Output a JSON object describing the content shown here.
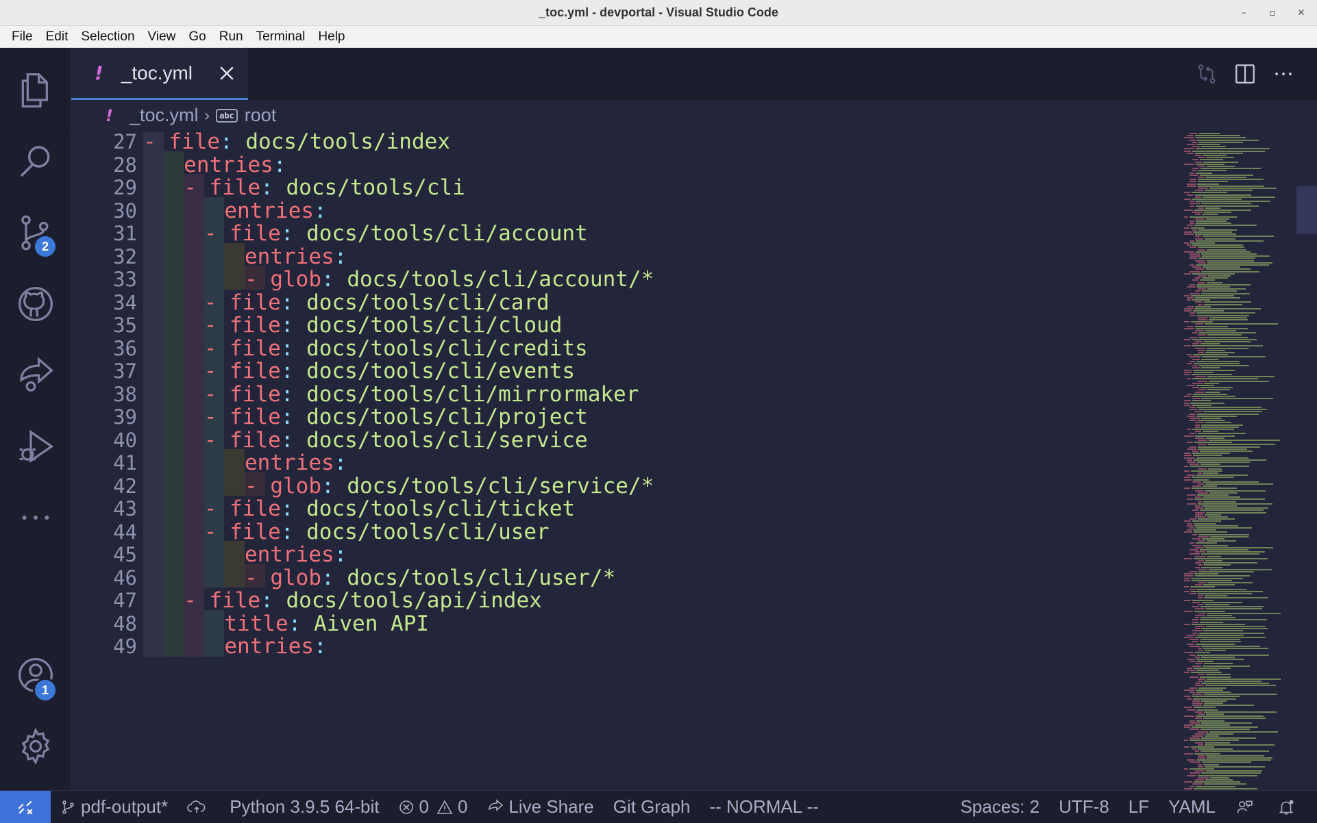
{
  "window": {
    "title": "_toc.yml - devportal - Visual Studio Code"
  },
  "menu": [
    "File",
    "Edit",
    "Selection",
    "View",
    "Go",
    "Run",
    "Terminal",
    "Help"
  ],
  "activity": {
    "source_control_badge": "2",
    "accounts_badge": "1"
  },
  "tab": {
    "bang": "!",
    "name": "_toc.yml"
  },
  "breadcrumb": {
    "bang": "!",
    "file": "_toc.yml",
    "symbol_icon": "abc",
    "symbol": "root"
  },
  "editor": {
    "lines": [
      {
        "n": "27",
        "indent": 1,
        "dash": true,
        "key": "file",
        "value": "docs/tools/index"
      },
      {
        "n": "28",
        "indent": 2,
        "dash": false,
        "key": "entries",
        "value": ""
      },
      {
        "n": "29",
        "indent": 3,
        "dash": true,
        "key": "file",
        "value": "docs/tools/cli"
      },
      {
        "n": "30",
        "indent": 4,
        "dash": false,
        "key": "entries",
        "value": ""
      },
      {
        "n": "31",
        "indent": 4,
        "dash": true,
        "key": "file",
        "value": "docs/tools/cli/account"
      },
      {
        "n": "32",
        "indent": 5,
        "dash": false,
        "key": "entries",
        "value": ""
      },
      {
        "n": "33",
        "indent": 6,
        "dash": true,
        "key": "glob",
        "value": "docs/tools/cli/account/*"
      },
      {
        "n": "34",
        "indent": 4,
        "dash": true,
        "key": "file",
        "value": "docs/tools/cli/card"
      },
      {
        "n": "35",
        "indent": 4,
        "dash": true,
        "key": "file",
        "value": "docs/tools/cli/cloud"
      },
      {
        "n": "36",
        "indent": 4,
        "dash": true,
        "key": "file",
        "value": "docs/tools/cli/credits"
      },
      {
        "n": "37",
        "indent": 4,
        "dash": true,
        "key": "file",
        "value": "docs/tools/cli/events"
      },
      {
        "n": "38",
        "indent": 4,
        "dash": true,
        "key": "file",
        "value": "docs/tools/cli/mirrormaker"
      },
      {
        "n": "39",
        "indent": 4,
        "dash": true,
        "key": "file",
        "value": "docs/tools/cli/project"
      },
      {
        "n": "40",
        "indent": 4,
        "dash": true,
        "key": "file",
        "value": "docs/tools/cli/service"
      },
      {
        "n": "41",
        "indent": 5,
        "dash": false,
        "key": "entries",
        "value": ""
      },
      {
        "n": "42",
        "indent": 6,
        "dash": true,
        "key": "glob",
        "value": "docs/tools/cli/service/*"
      },
      {
        "n": "43",
        "indent": 4,
        "dash": true,
        "key": "file",
        "value": "docs/tools/cli/ticket"
      },
      {
        "n": "44",
        "indent": 4,
        "dash": true,
        "key": "file",
        "value": "docs/tools/cli/user"
      },
      {
        "n": "45",
        "indent": 5,
        "dash": false,
        "key": "entries",
        "value": ""
      },
      {
        "n": "46",
        "indent": 6,
        "dash": true,
        "key": "glob",
        "value": "docs/tools/cli/user/*"
      },
      {
        "n": "47",
        "indent": 3,
        "dash": true,
        "key": "file",
        "value": "docs/tools/api/index"
      },
      {
        "n": "48",
        "indent": 4,
        "dash": false,
        "key": "title",
        "value": "Aiven API"
      },
      {
        "n": "49",
        "indent": 4,
        "dash": false,
        "key": "entries",
        "value": ""
      }
    ]
  },
  "status": {
    "branch": "pdf-output*",
    "python": "Python 3.9.5 64-bit",
    "errors": "0",
    "warnings": "0",
    "live_share": "Live Share",
    "git_graph": "Git Graph",
    "vim_mode": "-- NORMAL --",
    "spaces": "Spaces: 2",
    "encoding": "UTF-8",
    "eol": "LF",
    "language": "YAML"
  },
  "colors": {
    "key": "#f07178",
    "value": "#c3e88d",
    "accent": "#3f72d9",
    "background": "#23253a"
  }
}
